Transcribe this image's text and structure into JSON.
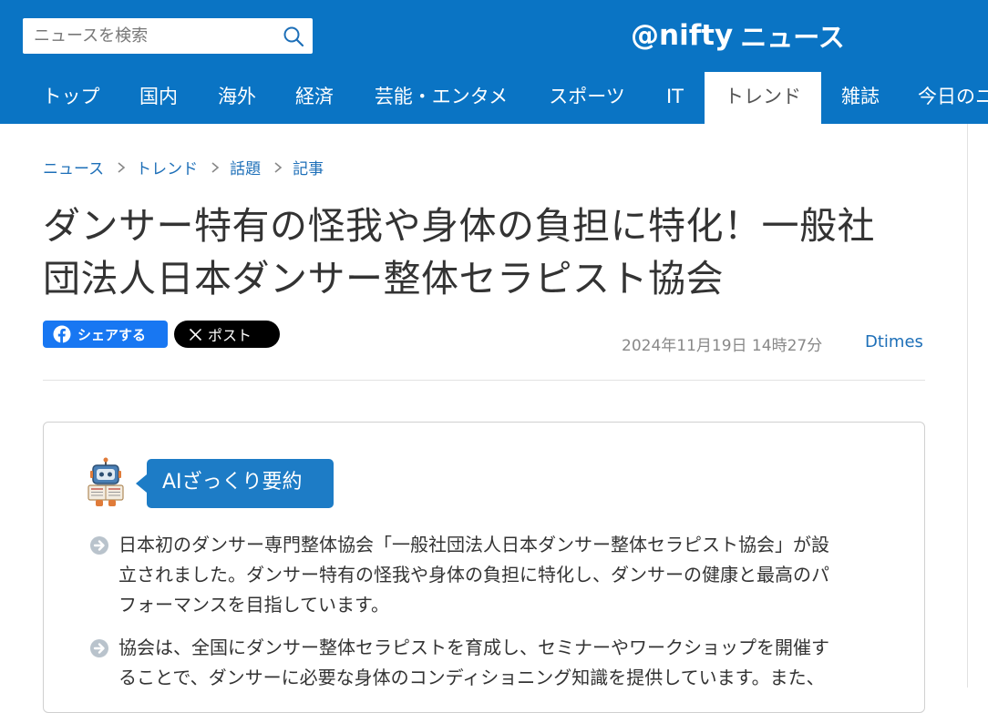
{
  "search": {
    "placeholder": "ニュースを検索"
  },
  "logo": {
    "part1": "@nifty",
    "part2": "ニュース"
  },
  "nav": {
    "items": [
      {
        "label": "トップ",
        "active": false
      },
      {
        "label": "国内",
        "active": false
      },
      {
        "label": "海外",
        "active": false
      },
      {
        "label": "経済",
        "active": false
      },
      {
        "label": "芸能・エンタメ",
        "active": false
      },
      {
        "label": "スポーツ",
        "active": false
      },
      {
        "label": "IT",
        "active": false
      },
      {
        "label": "トレンド",
        "active": true
      },
      {
        "label": "雑誌",
        "active": false
      },
      {
        "label": "今日のニ",
        "active": false
      }
    ]
  },
  "breadcrumb": [
    "ニュース",
    "トレンド",
    "話題",
    "記事"
  ],
  "article": {
    "title_line1": "ダンサー特有の怪我や身体の負担に特化！一般社",
    "title_line2": "団法人日本ダンサー整体セラピスト協会",
    "date": "2024年11月19日 14時27分",
    "source": "Dtimes"
  },
  "share": {
    "facebook_label": "シェアする",
    "x_label": "ポスト"
  },
  "summary": {
    "badge": "AIざっくり要約",
    "bullets": [
      {
        "lines": [
          "日本初のダンサー専門整体協会「一般社団法人日本ダンサー整体セラピスト協会」が設",
          "立されました。ダンサー特有の怪我や身体の負担に特化し、ダンサーの健康と最高のパ",
          "フォーマンスを目指しています。"
        ]
      },
      {
        "lines": [
          "協会は、全国にダンサー整体セラピストを育成し、セミナーやワークショップを開催す",
          "ることで、ダンサーに必要な身体のコンディショニング知識を提供しています。また、"
        ]
      }
    ]
  },
  "colors": {
    "brand": "#0a74c4",
    "link": "#1d6fb8",
    "facebook": "#1877f2",
    "badge": "#1d7cc6"
  }
}
